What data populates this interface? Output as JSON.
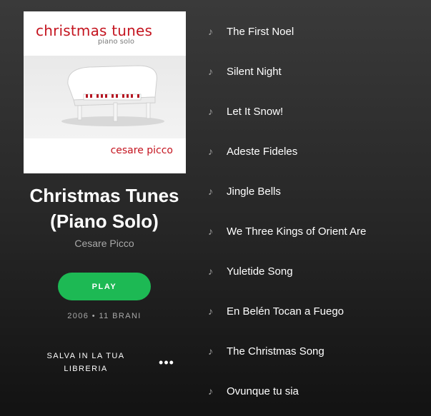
{
  "cover": {
    "title": "christmas tunes",
    "subtitle": "piano solo",
    "artist": "cesare picco"
  },
  "album": {
    "title_line1": "Christmas Tunes",
    "title_line2": "(Piano Solo)",
    "artist": "Cesare Picco",
    "play_label": "PLAY",
    "meta": "2006 • 11 BRANI",
    "save_line1": "SALVA IN LA TUA",
    "save_line2": "LIBRERIA",
    "more_label": "•••"
  },
  "tracks": [
    {
      "name": "The First Noel",
      "icon": "music-note-icon"
    },
    {
      "name": "Silent Night",
      "icon": "music-note-icon"
    },
    {
      "name": "Let It Snow!",
      "icon": "music-note-icon"
    },
    {
      "name": "Adeste Fideles",
      "icon": "music-note-icon"
    },
    {
      "name": "Jingle Bells",
      "icon": "music-note-icon"
    },
    {
      "name": "We Three Kings of Orient Are",
      "icon": "music-note-icon"
    },
    {
      "name": "Yuletide Song",
      "icon": "music-note-icon"
    },
    {
      "name": "En Belén Tocan a Fuego",
      "icon": "music-note-icon"
    },
    {
      "name": "The Christmas Song",
      "icon": "music-note-icon"
    },
    {
      "name": "Ovunque tu sia",
      "icon": "music-note-icon"
    }
  ],
  "colors": {
    "play_button": "#1db954",
    "cover_accent": "#c4141f",
    "muted_text": "#a9a9a9"
  }
}
